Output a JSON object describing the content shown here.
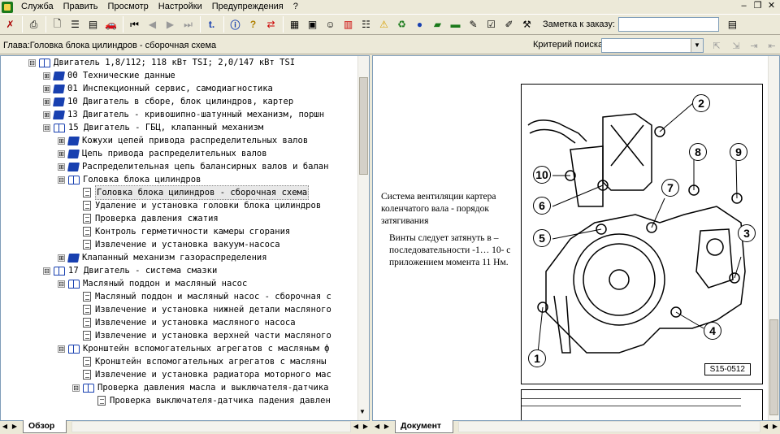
{
  "menu": {
    "items": [
      "Служба",
      "Править",
      "Просмотр",
      "Настройки",
      "Предупреждения",
      "?"
    ]
  },
  "toolbar": {
    "order_label": "Заметка к заказу:",
    "order_value": ""
  },
  "chapter": {
    "text": "Глава:Головка блока цилиндров - сборочная схема"
  },
  "search": {
    "label": "Критерий поиска:",
    "value": ""
  },
  "tree": {
    "nodes": [
      {
        "indent": 1,
        "exp": "⊟",
        "icon": "book-open",
        "label": "Двигатель 1,8/112; 118 кВт TSI; 2,0/147 кВт TSI"
      },
      {
        "indent": 2,
        "exp": "⊞",
        "icon": "book",
        "label": "00 Технические данные"
      },
      {
        "indent": 2,
        "exp": "⊞",
        "icon": "book",
        "label": "01 Инспекционный сервис, самодиагностика"
      },
      {
        "indent": 2,
        "exp": "⊞",
        "icon": "book",
        "label": "10 Двигатель в сборе, блок цилиндров, картер"
      },
      {
        "indent": 2,
        "exp": "⊞",
        "icon": "book",
        "label": "13 Двигатель - кривошипно-шатунный механизм, поршн"
      },
      {
        "indent": 2,
        "exp": "⊟",
        "icon": "book-open",
        "label": "15 Двигатель - ГБЦ, клапанный механизм"
      },
      {
        "indent": 3,
        "exp": "⊞",
        "icon": "book",
        "label": "Кожухи цепей привода распределительных валов"
      },
      {
        "indent": 3,
        "exp": "⊞",
        "icon": "book",
        "label": "Цепь привода распределительных валов"
      },
      {
        "indent": 3,
        "exp": "⊞",
        "icon": "book",
        "label": "Распределительная цепь балансирных валов и балан"
      },
      {
        "indent": 3,
        "exp": "⊟",
        "icon": "book-open",
        "label": "Головка блока цилиндров"
      },
      {
        "indent": 4,
        "exp": "",
        "icon": "page",
        "label": "Головка блока цилиндров - сборочная схема",
        "selected": true
      },
      {
        "indent": 4,
        "exp": "",
        "icon": "page",
        "label": "Удаление и установка головки блока цилиндров"
      },
      {
        "indent": 4,
        "exp": "",
        "icon": "page",
        "label": "Проверка давления сжатия"
      },
      {
        "indent": 4,
        "exp": "",
        "icon": "page",
        "label": "Контроль герметичности камеры сгорания"
      },
      {
        "indent": 4,
        "exp": "",
        "icon": "page",
        "label": "Извлечение и установка вакуум-насоса"
      },
      {
        "indent": 3,
        "exp": "⊞",
        "icon": "book",
        "label": "Клапанный механизм газораспределения"
      },
      {
        "indent": 2,
        "exp": "⊟",
        "icon": "book-open",
        "label": "17 Двигатель - система смазки"
      },
      {
        "indent": 3,
        "exp": "⊟",
        "icon": "book-open",
        "label": "Масляный поддон и масляный насос"
      },
      {
        "indent": 4,
        "exp": "",
        "icon": "page",
        "label": "Масляный поддон и масляный насос - сборочная с"
      },
      {
        "indent": 4,
        "exp": "",
        "icon": "page",
        "label": "Извлечение и установка нижней детали масляного"
      },
      {
        "indent": 4,
        "exp": "",
        "icon": "page",
        "label": "Извлечение и установка масляного насоса"
      },
      {
        "indent": 4,
        "exp": "",
        "icon": "page",
        "label": "Извлечение и установка верхней части масляного"
      },
      {
        "indent": 3,
        "exp": "⊟",
        "icon": "book-open",
        "label": "Кронштейн вспомогательных агрегатов с масляным ф"
      },
      {
        "indent": 4,
        "exp": "",
        "icon": "page",
        "label": "Кронштейн вспомогательных агрегатов с масляны"
      },
      {
        "indent": 4,
        "exp": "",
        "icon": "page",
        "label": "Извлечение и установка радиатора моторного мас"
      },
      {
        "indent": 4,
        "exp": "⊟",
        "icon": "book-open",
        "label": "Проверка давления масла и выключателя-датчика"
      },
      {
        "indent": 5,
        "exp": "",
        "icon": "page",
        "label": "Проверка выключателя-датчика падения давлен"
      }
    ]
  },
  "doc": {
    "heading": "Система вентиляции картера коленчатого вала - порядок затягивания",
    "body": "Винты следует затянуть в – последовательности -1… 10- с приложением момента 11 Нм.",
    "figure_code": "S15-0512",
    "callouts": [
      "2",
      "8",
      "9",
      "10",
      "6",
      "7",
      "5",
      "3",
      "4",
      "1"
    ]
  },
  "tabs": {
    "left": "Обзор",
    "right": "Документ"
  }
}
